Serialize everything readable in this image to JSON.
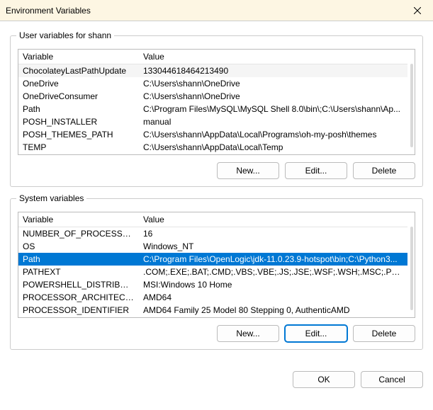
{
  "window": {
    "title": "Environment Variables"
  },
  "user_group": {
    "legend": "User variables for shann",
    "columns": {
      "variable": "Variable",
      "value": "Value"
    },
    "rows": [
      {
        "variable": "ChocolateyLastPathUpdate",
        "value": "133044618464213490"
      },
      {
        "variable": "OneDrive",
        "value": "C:\\Users\\shann\\OneDrive"
      },
      {
        "variable": "OneDriveConsumer",
        "value": "C:\\Users\\shann\\OneDrive"
      },
      {
        "variable": "Path",
        "value": "C:\\Program Files\\MySQL\\MySQL Shell 8.0\\bin\\;C:\\Users\\shann\\Ap..."
      },
      {
        "variable": "POSH_INSTALLER",
        "value": "manual"
      },
      {
        "variable": "POSH_THEMES_PATH",
        "value": "C:\\Users\\shann\\AppData\\Local\\Programs\\oh-my-posh\\themes"
      },
      {
        "variable": "TEMP",
        "value": "C:\\Users\\shann\\AppData\\Local\\Temp"
      }
    ],
    "buttons": {
      "new": "New...",
      "edit": "Edit...",
      "delete": "Delete"
    }
  },
  "system_group": {
    "legend": "System variables",
    "columns": {
      "variable": "Variable",
      "value": "Value"
    },
    "rows": [
      {
        "variable": "NUMBER_OF_PROCESSORS",
        "value": "16"
      },
      {
        "variable": "OS",
        "value": "Windows_NT"
      },
      {
        "variable": "Path",
        "value": "C:\\Program Files\\OpenLogic\\jdk-11.0.23.9-hotspot\\bin;C:\\Python3..."
      },
      {
        "variable": "PATHEXT",
        "value": ".COM;.EXE;.BAT;.CMD;.VBS;.VBE;.JS;.JSE;.WSF;.WSH;.MSC;.PY;.PYW"
      },
      {
        "variable": "POWERSHELL_DISTRIBUTIO...",
        "value": "MSI:Windows 10 Home"
      },
      {
        "variable": "PROCESSOR_ARCHITECTURE",
        "value": "AMD64"
      },
      {
        "variable": "PROCESSOR_IDENTIFIER",
        "value": "AMD64 Family 25 Model 80 Stepping 0, AuthenticAMD"
      }
    ],
    "selected_index": 2,
    "buttons": {
      "new": "New...",
      "edit": "Edit...",
      "delete": "Delete"
    }
  },
  "dialog_buttons": {
    "ok": "OK",
    "cancel": "Cancel"
  }
}
